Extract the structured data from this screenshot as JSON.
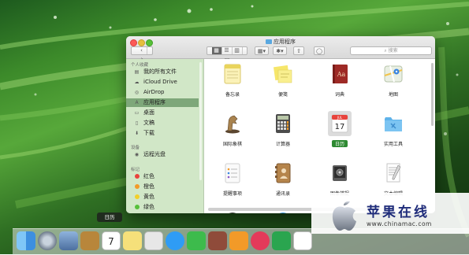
{
  "window": {
    "title": "应用程序",
    "search_placeholder": "搜索",
    "toolbar": {
      "back": "‹",
      "forward": "›",
      "view_icons": "▦",
      "view_list": "☰",
      "view_columns": "▥",
      "view_coverflow": "▭",
      "arrange": "▦▾",
      "action": "✱▾",
      "share": "⇧",
      "tags": "◯"
    }
  },
  "sidebar": {
    "sections": [
      {
        "title": "个人收藏"
      },
      {
        "title": "设备"
      },
      {
        "title": "标记"
      }
    ],
    "favorites": [
      {
        "label": "我的所有文件",
        "icon": "all-files-icon",
        "glyph": "▤"
      },
      {
        "label": "iCloud Drive",
        "icon": "cloud-icon",
        "glyph": "☁"
      },
      {
        "label": "AirDrop",
        "icon": "airdrop-icon",
        "glyph": "◎"
      },
      {
        "label": "应用程序",
        "icon": "applications-icon",
        "glyph": "A"
      },
      {
        "label": "桌面",
        "icon": "desktop-icon",
        "glyph": "▭"
      },
      {
        "label": "文稿",
        "icon": "documents-icon",
        "glyph": "▯"
      },
      {
        "label": "下载",
        "icon": "download-icon",
        "glyph": "⬇"
      }
    ],
    "devices": [
      {
        "label": "远程光盘",
        "icon": "disc-icon",
        "glyph": "◉"
      }
    ],
    "tags": [
      {
        "label": "红色",
        "color": "#e8433c"
      },
      {
        "label": "橙色",
        "color": "#f29a28"
      },
      {
        "label": "黄色",
        "color": "#f2cf2a"
      },
      {
        "label": "绿色",
        "color": "#56c03a"
      }
    ]
  },
  "apps": [
    {
      "label": "备忘录",
      "icon": "notes-icon"
    },
    {
      "label": "便笺",
      "icon": "stickies-icon"
    },
    {
      "label": "词典",
      "icon": "dictionary-icon",
      "glyph": "Aa"
    },
    {
      "label": "地图",
      "icon": "maps-icon"
    },
    {
      "label": "国际象棋",
      "icon": "chess-icon",
      "glyph": "♞"
    },
    {
      "label": "计算器",
      "icon": "calculator-icon"
    },
    {
      "label": "日历",
      "icon": "calendar-icon",
      "month": "JUL",
      "day": "17"
    },
    {
      "label": "实用工具",
      "icon": "utilities-folder-icon"
    },
    {
      "label": "提醒事项",
      "icon": "reminders-icon"
    },
    {
      "label": "通讯录",
      "icon": "contacts-icon"
    },
    {
      "label": "图像捕捉",
      "icon": "image-capture-icon"
    },
    {
      "label": "文本编辑",
      "icon": "textedit-icon"
    }
  ],
  "dock": {
    "tooltip": "日历",
    "calendar_day": "7",
    "items": [
      {
        "name": "finder-icon",
        "color": "#3d8fe0"
      },
      {
        "name": "launchpad-icon",
        "color": "#6d7a8a"
      },
      {
        "name": "preview-icon",
        "color": "#4c6f9f"
      },
      {
        "name": "notes-icon",
        "color": "#b8863b"
      },
      {
        "name": "calendar-icon",
        "color": "#ffffff"
      },
      {
        "name": "stickies-icon",
        "color": "#f5e07a"
      },
      {
        "name": "photos-icon",
        "color": "#e7e7e7"
      },
      {
        "name": "messages-icon",
        "color": "#2f9cf5"
      },
      {
        "name": "facetime-icon",
        "color": "#3dbb4c"
      },
      {
        "name": "photo-booth-icon",
        "color": "#8f4b3a"
      },
      {
        "name": "ibooks-icon",
        "color": "#f29a28"
      },
      {
        "name": "itunes-icon",
        "color": "#e43a5a"
      },
      {
        "name": "numbers-icon",
        "color": "#2aa54f"
      },
      {
        "name": "keynote-icon",
        "color": "#ffffff"
      }
    ]
  },
  "watermark": {
    "name": "苹果在线",
    "url": "www.chinamac.com"
  }
}
